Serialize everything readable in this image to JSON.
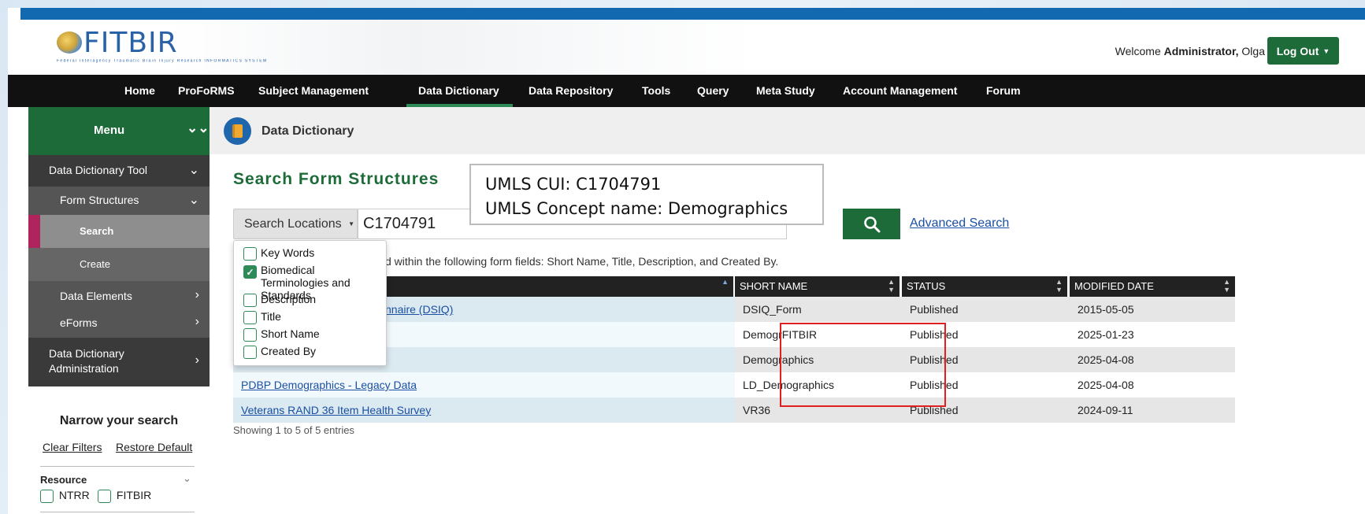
{
  "header": {
    "logo_text": "FITBIR",
    "logo_subtitle": "Federal Interagency Traumatic Brain Injury Research INFORMATICS SYSTEM",
    "welcome_prefix": "Welcome",
    "welcome_user": "Administrator,",
    "welcome_name": "Olga",
    "logout_label": "Log Out"
  },
  "nav": {
    "items": [
      "Home",
      "ProFoRMS",
      "Subject Management",
      "Data Dictionary",
      "Data Repository",
      "Tools",
      "Query",
      "Meta Study",
      "Account Management",
      "Forum"
    ],
    "active": "Data Dictionary"
  },
  "sidebar": {
    "menu_label": "Menu",
    "items": [
      {
        "label": "Data Dictionary Tool"
      },
      {
        "label": "Form Structures"
      },
      {
        "label": "Search"
      },
      {
        "label": "Create"
      },
      {
        "label": "Data Elements"
      },
      {
        "label": "eForms"
      },
      {
        "label": "Data Dictionary Administration"
      }
    ],
    "narrow_title": "Narrow your search",
    "clear_filters": "Clear Filters",
    "restore_default": "Restore Default",
    "resource_label": "Resource",
    "resources": [
      "NTRR",
      "FITBIR"
    ]
  },
  "page": {
    "title": "Data Dictionary",
    "search_title": "Search Form Structures",
    "search_locations_label": "Search Locations",
    "search_value": "C1704791",
    "advanced_search": "Advanced Search",
    "hint_visible": "d within the following form fields: Short Name, Title, Description, and Created By.",
    "showing": "Showing 1 to 5 of 5 entries"
  },
  "search_locations": [
    {
      "label": "Key Words",
      "checked": false
    },
    {
      "label": "Biomedical Terminologies and Standards",
      "checked": true
    },
    {
      "label": "Description",
      "checked": false
    },
    {
      "label": "Title",
      "checked": false
    },
    {
      "label": "Short Name",
      "checked": false
    },
    {
      "label": "Created By",
      "checked": false
    }
  ],
  "table": {
    "columns": [
      "SHORT NAME",
      "STATUS",
      "MODIFIED DATE"
    ],
    "rows": [
      {
        "title": "nnaire (DSIQ)",
        "short_name": "DSIQ_Form",
        "status": "Published",
        "modified": "2015-05-05"
      },
      {
        "title": "",
        "short_name": "DemogrFITBIR",
        "status": "Published",
        "modified": "2025-01-23"
      },
      {
        "title": "",
        "short_name": "Demographics",
        "status": "Published",
        "modified": "2025-04-08"
      },
      {
        "title": "PDBP Demographics - Legacy Data",
        "short_name": "LD_Demographics",
        "status": "Published",
        "modified": "2025-04-08"
      },
      {
        "title": "Veterans RAND 36 Item Health Survey",
        "short_name": "VR36",
        "status": "Published",
        "modified": "2024-09-11"
      }
    ]
  },
  "annotation": {
    "line1": "UMLS CUI: C1704791",
    "line2": "UMLS Concept name: Demographics"
  },
  "colors": {
    "brand_green": "#1e6b3a",
    "top_blue": "#1269b0",
    "link_blue": "#1a4fa3",
    "highlight_red": "#e02020",
    "active_side_marker": "#b0245e"
  }
}
